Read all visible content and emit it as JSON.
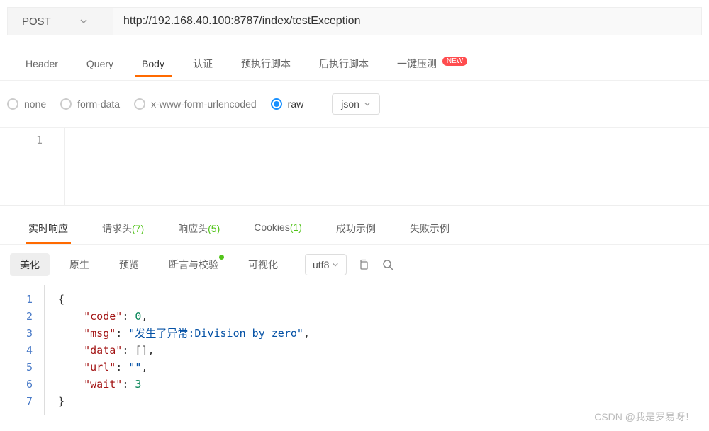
{
  "request": {
    "method": "POST",
    "url": "http://192.168.40.100:8787/index/testException"
  },
  "tabs": {
    "header": "Header",
    "query": "Query",
    "body": "Body",
    "auth": "认证",
    "preScript": "预执行脚本",
    "postScript": "后执行脚本",
    "pressure": "一键压测",
    "newBadge": "NEW"
  },
  "bodyOptions": {
    "none": "none",
    "formData": "form-data",
    "urlencoded": "x-www-form-urlencoded",
    "raw": "raw",
    "format": "json"
  },
  "editorLine": "1",
  "responseTabs": {
    "realtime": "实时响应",
    "reqHeaders": "请求头",
    "reqHeadersCount": "(7)",
    "respHeaders": "响应头",
    "respHeadersCount": "(5)",
    "cookies": "Cookies",
    "cookiesCount": "(1)",
    "successEx": "成功示例",
    "failEx": "失败示例"
  },
  "toolbar": {
    "beautify": "美化",
    "raw": "原生",
    "preview": "预览",
    "assert": "断言与校验",
    "visual": "可视化",
    "encoding": "utf8"
  },
  "responseJson": {
    "lines": [
      "1",
      "2",
      "3",
      "4",
      "5",
      "6",
      "7"
    ],
    "open": "{",
    "codeKey": "\"code\"",
    "codeVal": "0",
    "msgKey": "\"msg\"",
    "msgVal": "\"发生了异常:Division by zero\"",
    "dataKey": "\"data\"",
    "dataVal": "[]",
    "urlKey": "\"url\"",
    "urlVal": "\"\"",
    "waitKey": "\"wait\"",
    "waitVal": "3",
    "close": "}"
  },
  "watermark": "CSDN @我是罗易呀！"
}
